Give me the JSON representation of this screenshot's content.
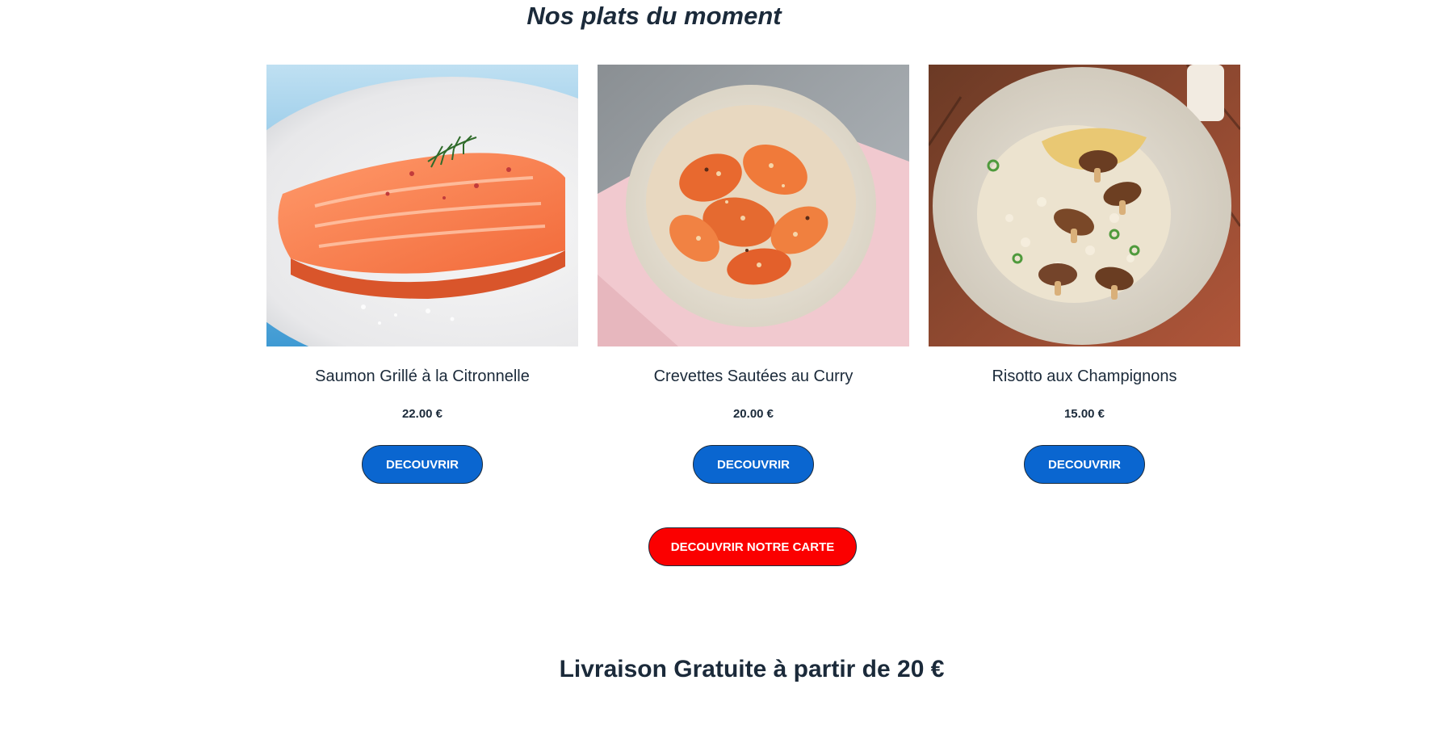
{
  "section": {
    "title": "Nos plats du moment"
  },
  "dishes": [
    {
      "name": "Saumon Grillé à la Citronnelle",
      "price": "22.00 €",
      "button_label": "DECOUVRIR",
      "image": "grilled-salmon-photo"
    },
    {
      "name": "Crevettes Sautées au Curry",
      "price": "20.00 €",
      "button_label": "DECOUVRIR",
      "image": "curry-shrimp-photo"
    },
    {
      "name": "Risotto aux Champignons",
      "price": "15.00 €",
      "button_label": "DECOUVRIR",
      "image": "mushroom-risotto-photo"
    }
  ],
  "menu_button": {
    "label": "DECOUVRIR NOTRE CARTE"
  },
  "delivery": {
    "text": "Livraison Gratuite à partir de 20 €"
  },
  "colors": {
    "text": "#1b2a3a",
    "primary_button": "#0a66d0",
    "menu_button": "#fb0000",
    "background": "#ffffff"
  }
}
